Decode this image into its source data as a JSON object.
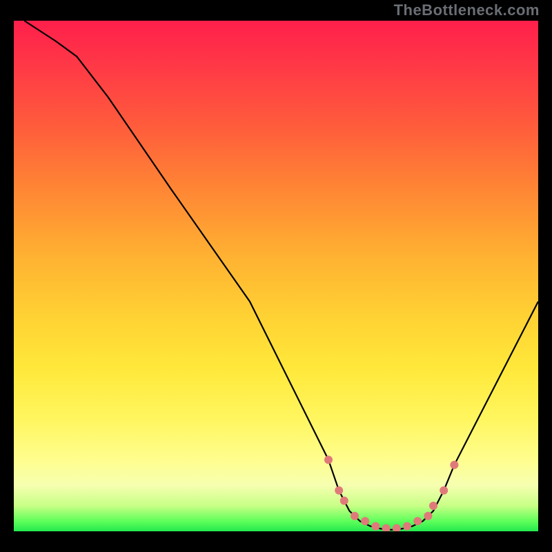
{
  "watermark": "TheBottleneck.com",
  "chart_data": {
    "type": "line",
    "title": "",
    "xlabel": "",
    "ylabel": "",
    "xlim": [
      0,
      100
    ],
    "ylim": [
      0,
      100
    ],
    "series": [
      {
        "name": "curve",
        "x": [
          2,
          8,
          12,
          18,
          30,
          45,
          60,
          62,
          64,
          66,
          68,
          70,
          72,
          74,
          76,
          78,
          80,
          82,
          84,
          100
        ],
        "y": [
          100,
          96,
          93,
          85,
          67,
          45,
          14,
          8,
          4,
          2,
          1,
          0.5,
          0.3,
          0.5,
          1,
          2,
          4,
          8,
          13,
          45
        ]
      }
    ],
    "markers": {
      "name": "marker-dots",
      "color": "#e07a7a",
      "x": [
        60,
        62,
        63,
        65,
        67,
        69,
        71,
        73,
        75,
        77,
        79,
        80,
        82,
        84
      ],
      "y": [
        14,
        8,
        6,
        3,
        2,
        1,
        0.6,
        0.6,
        1,
        2,
        3,
        5,
        8,
        13
      ]
    },
    "gradient_stops": [
      {
        "pos": 0,
        "color": "#ff1f4b"
      },
      {
        "pos": 8,
        "color": "#ff3647"
      },
      {
        "pos": 20,
        "color": "#ff5a3c"
      },
      {
        "pos": 33,
        "color": "#ff8634"
      },
      {
        "pos": 46,
        "color": "#ffb132"
      },
      {
        "pos": 58,
        "color": "#ffd233"
      },
      {
        "pos": 68,
        "color": "#ffe83a"
      },
      {
        "pos": 78,
        "color": "#fff65f"
      },
      {
        "pos": 86,
        "color": "#fffe8e"
      },
      {
        "pos": 91,
        "color": "#f6ffb0"
      },
      {
        "pos": 95,
        "color": "#c8ff86"
      },
      {
        "pos": 98,
        "color": "#5fff5a"
      },
      {
        "pos": 100,
        "color": "#23e94f"
      }
    ]
  }
}
